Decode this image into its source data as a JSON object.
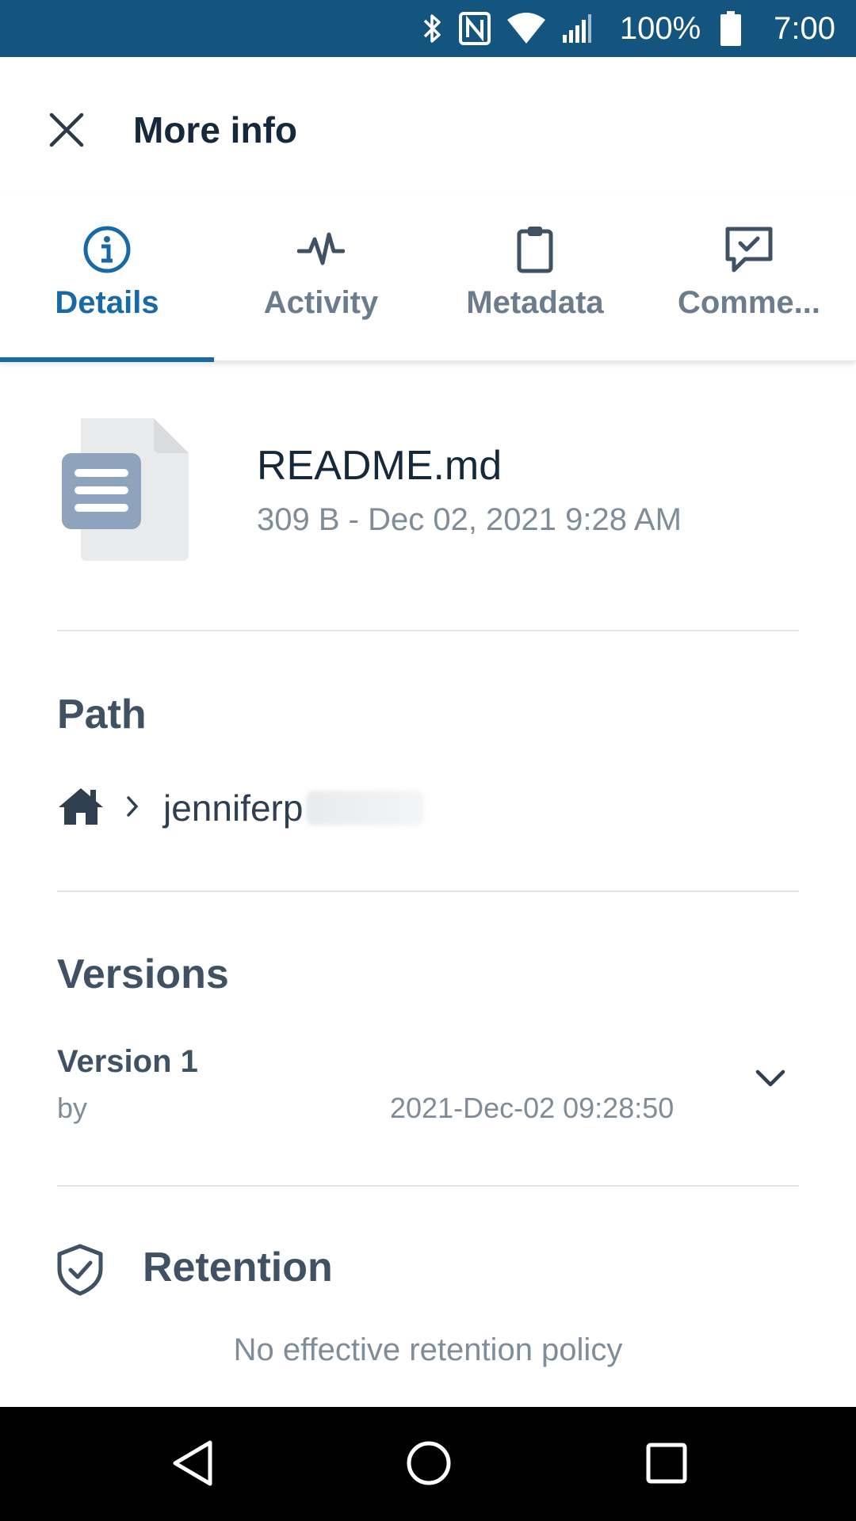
{
  "status_bar": {
    "battery": "100%",
    "time": "7:00",
    "icons": [
      "bluetooth-icon",
      "nfc-icon",
      "wifi-icon",
      "signal-icon",
      "battery-icon"
    ]
  },
  "header": {
    "title": "More info",
    "close_icon": "close-icon"
  },
  "tabs": [
    {
      "label": "Details",
      "icon": "info-icon",
      "active": true
    },
    {
      "label": "Activity",
      "icon": "activity-icon",
      "active": false
    },
    {
      "label": "Metadata",
      "icon": "clipboard-icon",
      "active": false
    },
    {
      "label": "Comme...",
      "icon": "comment-icon",
      "active": false
    }
  ],
  "file": {
    "name": "README.md",
    "meta": "309 B - Dec 02, 2021 9:28 AM",
    "icon": "document-icon"
  },
  "path": {
    "title": "Path",
    "home_icon": "home-icon",
    "segment": "jenniferp"
  },
  "versions": {
    "title": "Versions",
    "items": [
      {
        "label": "Version 1",
        "by": "by",
        "date": "2021-Dec-02 09:28:50"
      }
    ]
  },
  "retention": {
    "title": "Retention",
    "icon": "shield-check-icon",
    "note": "No effective retention policy"
  },
  "colors": {
    "status_bar": "#14557f",
    "accent": "#176aa6",
    "title_text": "#16293c",
    "section_text": "#3f5163",
    "muted_text": "#7f8c99",
    "nav_bar": "#000000"
  }
}
